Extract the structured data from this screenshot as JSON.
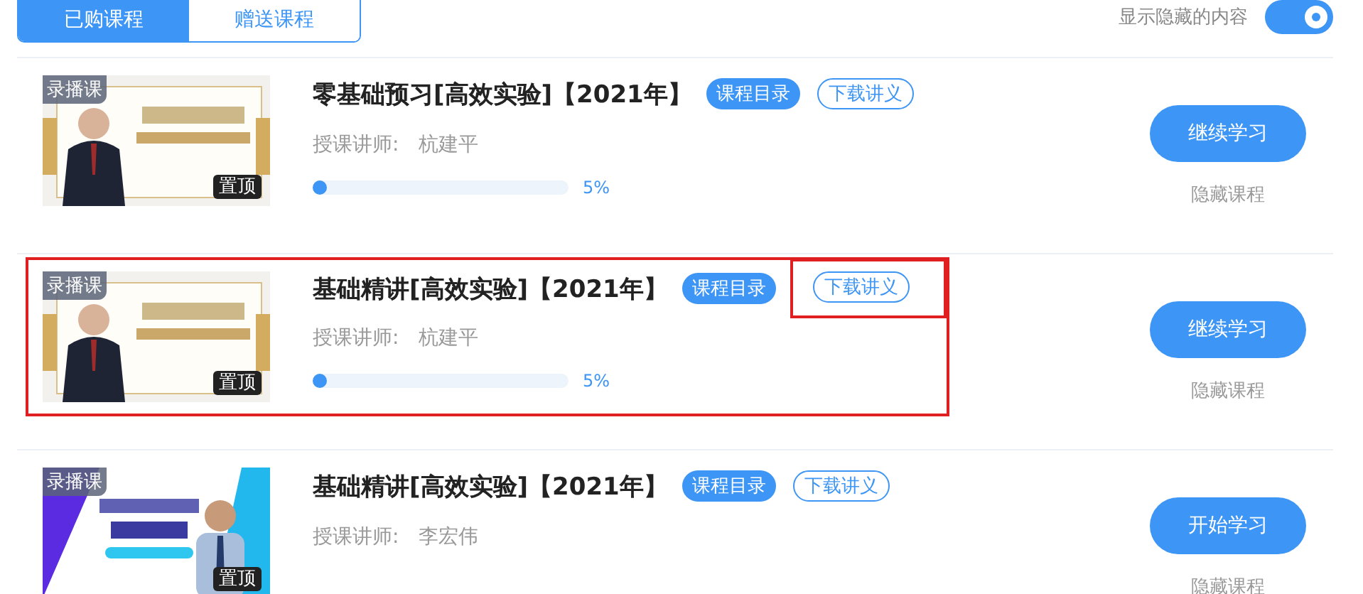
{
  "tabs": [
    {
      "label": "已购课程",
      "selected": true
    },
    {
      "label": "赠送课程",
      "selected": false
    }
  ],
  "hidden_toggle": {
    "label": "显示隐藏的内容",
    "on": true
  },
  "courses": [
    {
      "badge": "录播课",
      "pin": "置顶",
      "title": "零基础预习[高效实验]【2021年】",
      "catalog": "课程目录",
      "download": {
        "label": "下载讲义",
        "highlighted": false
      },
      "teacher_label": "授课讲师:",
      "teacher": "杭建平",
      "level": 0.05,
      "percent": "5%",
      "action": "继续学习",
      "hide": "隐藏课程",
      "highlighted": false
    },
    {
      "badge": "录播课",
      "pin": "置顶",
      "title": "基础精讲[高效实验]【2021年】",
      "catalog": "课程目录",
      "download": {
        "label": "下载讲义",
        "highlighted": true
      },
      "teacher_label": "授课讲师:",
      "teacher": "杭建平",
      "level": 0.05,
      "percent": "5%",
      "action": "继续学习",
      "hide": "隐藏课程",
      "highlighted": true
    },
    {
      "badge": "录播课",
      "pin": "置顶",
      "title": "基础精讲[高效实验]【2021年】",
      "catalog": "课程目录",
      "download": {
        "label": "下载讲义",
        "highlighted": false
      },
      "teacher_label": "授课讲师:",
      "teacher": "李宏伟",
      "action": "开始学习",
      "hide": "隐藏课程",
      "highlighted": false
    }
  ]
}
